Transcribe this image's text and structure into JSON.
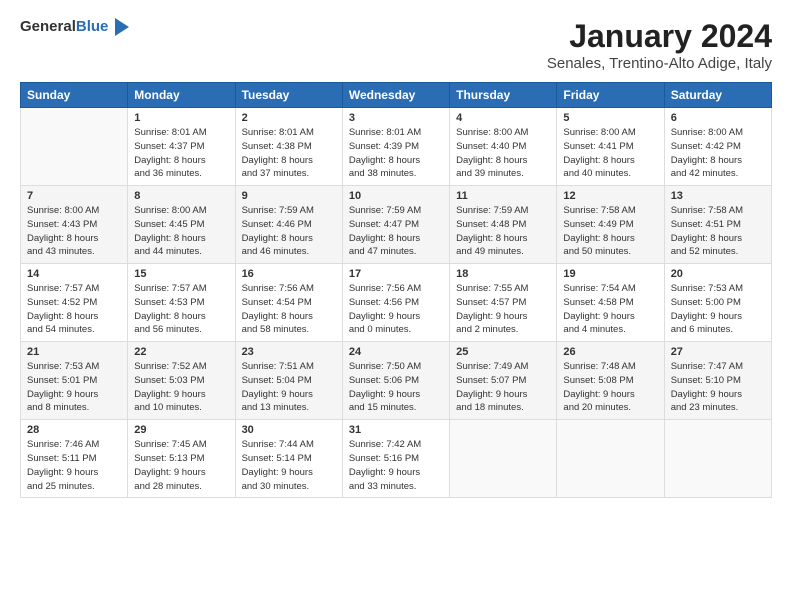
{
  "logo": {
    "line1": "General",
    "line2": "Blue"
  },
  "title": "January 2024",
  "location": "Senales, Trentino-Alto Adige, Italy",
  "headers": [
    "Sunday",
    "Monday",
    "Tuesday",
    "Wednesday",
    "Thursday",
    "Friday",
    "Saturday"
  ],
  "weeks": [
    [
      {
        "day": "",
        "info": ""
      },
      {
        "day": "1",
        "info": "Sunrise: 8:01 AM\nSunset: 4:37 PM\nDaylight: 8 hours\nand 36 minutes."
      },
      {
        "day": "2",
        "info": "Sunrise: 8:01 AM\nSunset: 4:38 PM\nDaylight: 8 hours\nand 37 minutes."
      },
      {
        "day": "3",
        "info": "Sunrise: 8:01 AM\nSunset: 4:39 PM\nDaylight: 8 hours\nand 38 minutes."
      },
      {
        "day": "4",
        "info": "Sunrise: 8:00 AM\nSunset: 4:40 PM\nDaylight: 8 hours\nand 39 minutes."
      },
      {
        "day": "5",
        "info": "Sunrise: 8:00 AM\nSunset: 4:41 PM\nDaylight: 8 hours\nand 40 minutes."
      },
      {
        "day": "6",
        "info": "Sunrise: 8:00 AM\nSunset: 4:42 PM\nDaylight: 8 hours\nand 42 minutes."
      }
    ],
    [
      {
        "day": "7",
        "info": "Sunrise: 8:00 AM\nSunset: 4:43 PM\nDaylight: 8 hours\nand 43 minutes."
      },
      {
        "day": "8",
        "info": "Sunrise: 8:00 AM\nSunset: 4:45 PM\nDaylight: 8 hours\nand 44 minutes."
      },
      {
        "day": "9",
        "info": "Sunrise: 7:59 AM\nSunset: 4:46 PM\nDaylight: 8 hours\nand 46 minutes."
      },
      {
        "day": "10",
        "info": "Sunrise: 7:59 AM\nSunset: 4:47 PM\nDaylight: 8 hours\nand 47 minutes."
      },
      {
        "day": "11",
        "info": "Sunrise: 7:59 AM\nSunset: 4:48 PM\nDaylight: 8 hours\nand 49 minutes."
      },
      {
        "day": "12",
        "info": "Sunrise: 7:58 AM\nSunset: 4:49 PM\nDaylight: 8 hours\nand 50 minutes."
      },
      {
        "day": "13",
        "info": "Sunrise: 7:58 AM\nSunset: 4:51 PM\nDaylight: 8 hours\nand 52 minutes."
      }
    ],
    [
      {
        "day": "14",
        "info": "Sunrise: 7:57 AM\nSunset: 4:52 PM\nDaylight: 8 hours\nand 54 minutes."
      },
      {
        "day": "15",
        "info": "Sunrise: 7:57 AM\nSunset: 4:53 PM\nDaylight: 8 hours\nand 56 minutes."
      },
      {
        "day": "16",
        "info": "Sunrise: 7:56 AM\nSunset: 4:54 PM\nDaylight: 8 hours\nand 58 minutes."
      },
      {
        "day": "17",
        "info": "Sunrise: 7:56 AM\nSunset: 4:56 PM\nDaylight: 9 hours\nand 0 minutes."
      },
      {
        "day": "18",
        "info": "Sunrise: 7:55 AM\nSunset: 4:57 PM\nDaylight: 9 hours\nand 2 minutes."
      },
      {
        "day": "19",
        "info": "Sunrise: 7:54 AM\nSunset: 4:58 PM\nDaylight: 9 hours\nand 4 minutes."
      },
      {
        "day": "20",
        "info": "Sunrise: 7:53 AM\nSunset: 5:00 PM\nDaylight: 9 hours\nand 6 minutes."
      }
    ],
    [
      {
        "day": "21",
        "info": "Sunrise: 7:53 AM\nSunset: 5:01 PM\nDaylight: 9 hours\nand 8 minutes."
      },
      {
        "day": "22",
        "info": "Sunrise: 7:52 AM\nSunset: 5:03 PM\nDaylight: 9 hours\nand 10 minutes."
      },
      {
        "day": "23",
        "info": "Sunrise: 7:51 AM\nSunset: 5:04 PM\nDaylight: 9 hours\nand 13 minutes."
      },
      {
        "day": "24",
        "info": "Sunrise: 7:50 AM\nSunset: 5:06 PM\nDaylight: 9 hours\nand 15 minutes."
      },
      {
        "day": "25",
        "info": "Sunrise: 7:49 AM\nSunset: 5:07 PM\nDaylight: 9 hours\nand 18 minutes."
      },
      {
        "day": "26",
        "info": "Sunrise: 7:48 AM\nSunset: 5:08 PM\nDaylight: 9 hours\nand 20 minutes."
      },
      {
        "day": "27",
        "info": "Sunrise: 7:47 AM\nSunset: 5:10 PM\nDaylight: 9 hours\nand 23 minutes."
      }
    ],
    [
      {
        "day": "28",
        "info": "Sunrise: 7:46 AM\nSunset: 5:11 PM\nDaylight: 9 hours\nand 25 minutes."
      },
      {
        "day": "29",
        "info": "Sunrise: 7:45 AM\nSunset: 5:13 PM\nDaylight: 9 hours\nand 28 minutes."
      },
      {
        "day": "30",
        "info": "Sunrise: 7:44 AM\nSunset: 5:14 PM\nDaylight: 9 hours\nand 30 minutes."
      },
      {
        "day": "31",
        "info": "Sunrise: 7:42 AM\nSunset: 5:16 PM\nDaylight: 9 hours\nand 33 minutes."
      },
      {
        "day": "",
        "info": ""
      },
      {
        "day": "",
        "info": ""
      },
      {
        "day": "",
        "info": ""
      }
    ]
  ]
}
